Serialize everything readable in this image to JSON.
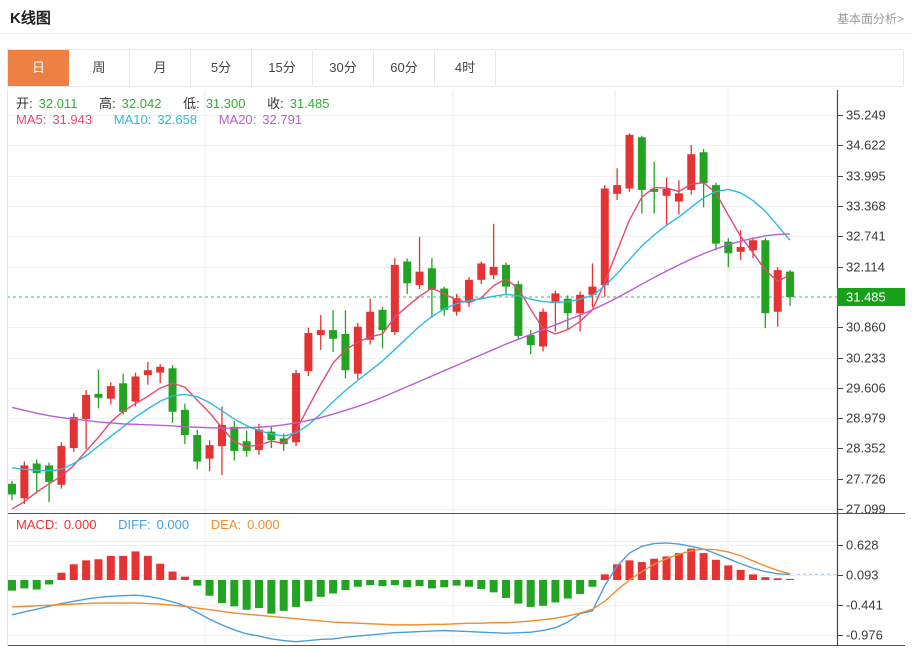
{
  "header": {
    "title": "K线图",
    "more_link": "基本面分析>"
  },
  "tabs": {
    "items": [
      "日",
      "周",
      "月",
      "5分",
      "15分",
      "30分",
      "60分",
      "4时"
    ],
    "active_index": 0
  },
  "ohlc_legend": {
    "open_label": "开:",
    "open_value": "32.011",
    "high_label": "高:",
    "high_value": "32.042",
    "low_label": "低:",
    "low_value": "31.300",
    "close_label": "收:",
    "close_value": "31.485"
  },
  "ma_legend": {
    "ma5_label": "MA5:",
    "ma5_value": "31.943",
    "ma10_label": "MA10:",
    "ma10_value": "32.658",
    "ma20_label": "MA20:",
    "ma20_value": "32.791"
  },
  "macd_legend": {
    "macd_label": "MACD:",
    "macd_value": "0.000",
    "diff_label": "DIFF:",
    "diff_value": "0.000",
    "dea_label": "DEA:",
    "dea_value": "0.000"
  },
  "colors": {
    "accent_orange": "#ee8043",
    "up_red": "#e53333",
    "down_green": "#22a422",
    "price_text_green": "#2db22d",
    "ma5_pink": "#e8476f",
    "ma10_cyan": "#29bcdc",
    "ma20_purple": "#bb5ed0",
    "diff_blue": "#4a9edc",
    "dea_orange": "#ef8d30",
    "current_price_bg": "#18a018",
    "dashed_green": "#3cb878",
    "grid": "#f0f0f0",
    "axis_dark": "#444444",
    "axis_text": "#3a3a3a",
    "link_gray": "#999999",
    "macd_tail_blue": "#a5c8e8"
  },
  "chart_data": {
    "type": "candlestick",
    "panes": [
      "price",
      "macd"
    ],
    "legend_position": "top-left",
    "grid": true,
    "current_price": "31.485",
    "price_axis_ticks": [
      "35.249",
      "34.622",
      "33.995",
      "33.368",
      "32.741",
      "32.114",
      "31.485",
      "30.860",
      "30.233",
      "29.606",
      "28.979",
      "28.352",
      "27.726",
      "27.099"
    ],
    "macd_axis_ticks": [
      "0.628",
      "0.093",
      "-0.441",
      "-0.976"
    ],
    "candles_ohlc": [
      [
        27.62,
        27.68,
        27.28,
        27.4
      ],
      [
        27.32,
        28.08,
        27.2,
        28.0
      ],
      [
        28.04,
        28.12,
        27.42,
        27.84
      ],
      [
        28.0,
        28.06,
        27.24,
        27.66
      ],
      [
        27.6,
        28.48,
        27.52,
        28.4
      ],
      [
        28.36,
        29.08,
        28.28,
        29.0
      ],
      [
        28.96,
        29.56,
        28.34,
        29.46
      ],
      [
        29.48,
        29.98,
        29.18,
        29.4
      ],
      [
        29.38,
        29.72,
        29.26,
        29.64
      ],
      [
        29.7,
        29.9,
        29.05,
        29.11
      ],
      [
        29.32,
        29.92,
        29.22,
        29.84
      ],
      [
        29.87,
        30.14,
        29.67,
        29.97
      ],
      [
        29.92,
        30.1,
        29.7,
        30.04
      ],
      [
        30.01,
        30.08,
        28.88,
        29.11
      ],
      [
        29.15,
        29.28,
        28.44,
        28.63
      ],
      [
        28.63,
        28.74,
        27.92,
        28.08
      ],
      [
        28.14,
        28.52,
        27.88,
        28.42
      ],
      [
        28.4,
        29.22,
        27.8,
        28.84
      ],
      [
        28.8,
        28.92,
        28.1,
        28.3
      ],
      [
        28.5,
        28.72,
        28.18,
        28.3
      ],
      [
        28.32,
        28.86,
        28.22,
        28.74
      ],
      [
        28.7,
        28.8,
        28.36,
        28.52
      ],
      [
        28.56,
        28.66,
        28.3,
        28.44
      ],
      [
        28.48,
        29.98,
        28.4,
        29.91
      ],
      [
        29.95,
        30.85,
        29.85,
        30.74
      ],
      [
        30.7,
        31.11,
        30.39,
        30.8
      ],
      [
        30.8,
        31.21,
        30.35,
        30.62
      ],
      [
        30.72,
        31.21,
        29.8,
        29.97
      ],
      [
        29.9,
        30.95,
        29.78,
        30.87
      ],
      [
        30.6,
        31.45,
        30.5,
        31.18
      ],
      [
        31.22,
        31.28,
        30.42,
        30.8
      ],
      [
        30.76,
        32.29,
        30.7,
        32.15
      ],
      [
        32.22,
        32.28,
        31.55,
        31.77
      ],
      [
        31.73,
        32.73,
        31.65,
        32.01
      ],
      [
        32.08,
        32.29,
        31.05,
        31.63
      ],
      [
        31.66,
        31.7,
        31.1,
        31.22
      ],
      [
        31.18,
        31.55,
        31.1,
        31.46
      ],
      [
        31.38,
        31.9,
        31.28,
        31.84
      ],
      [
        31.84,
        32.22,
        31.75,
        32.18
      ],
      [
        31.94,
        33.0,
        31.85,
        32.11
      ],
      [
        32.15,
        32.2,
        31.55,
        31.7
      ],
      [
        31.75,
        31.82,
        30.6,
        30.68
      ],
      [
        30.7,
        30.8,
        30.3,
        30.49
      ],
      [
        30.46,
        31.25,
        30.36,
        31.18
      ],
      [
        31.39,
        31.62,
        30.77,
        31.56
      ],
      [
        31.45,
        31.52,
        30.82,
        31.15
      ],
      [
        31.15,
        31.6,
        30.77,
        31.53
      ],
      [
        31.53,
        32.18,
        31.28,
        31.7
      ],
      [
        31.73,
        33.8,
        31.49,
        33.73
      ],
      [
        33.62,
        34.15,
        33.49,
        33.8
      ],
      [
        33.73,
        34.87,
        33.66,
        34.84
      ],
      [
        34.79,
        34.82,
        33.21,
        33.7
      ],
      [
        33.72,
        34.28,
        33.21,
        33.66
      ],
      [
        33.58,
        33.96,
        32.97,
        33.72
      ],
      [
        33.46,
        33.9,
        33.19,
        33.63
      ],
      [
        33.7,
        34.63,
        33.6,
        34.44
      ],
      [
        34.48,
        34.55,
        33.34,
        33.84
      ],
      [
        33.8,
        33.85,
        32.45,
        32.59
      ],
      [
        32.63,
        32.7,
        32.1,
        32.39
      ],
      [
        32.42,
        32.87,
        32.25,
        32.52
      ],
      [
        32.45,
        32.72,
        32.29,
        32.66
      ],
      [
        32.66,
        32.7,
        30.84,
        31.15
      ],
      [
        31.18,
        32.1,
        30.87,
        32.04
      ],
      [
        32.011,
        32.042,
        31.3,
        31.485
      ]
    ],
    "ma5": [
      27.1,
      27.25,
      27.45,
      27.62,
      27.78,
      28.0,
      28.3,
      28.58,
      28.9,
      29.12,
      29.28,
      29.43,
      29.6,
      29.7,
      29.62,
      29.35,
      29.09,
      28.78,
      28.49,
      28.39,
      28.42,
      28.5,
      28.46,
      28.72,
      29.21,
      29.68,
      30.12,
      30.39,
      30.55,
      30.66,
      30.72,
      31.07,
      31.29,
      31.5,
      31.67,
      31.55,
      31.42,
      31.37,
      31.47,
      31.72,
      31.86,
      31.66,
      31.23,
      30.83,
      30.72,
      30.81,
      30.98,
      31.22,
      31.79,
      32.44,
      33.08,
      33.55,
      33.75,
      33.74,
      33.67,
      33.82,
      33.85,
      33.64,
      33.18,
      32.74,
      32.4,
      32.04,
      31.81,
      31.94
    ],
    "ma10": [
      27.95,
      27.92,
      27.9,
      27.89,
      27.92,
      28.04,
      28.2,
      28.4,
      28.6,
      28.8,
      29.0,
      29.17,
      29.33,
      29.44,
      29.47,
      29.42,
      29.3,
      29.13,
      28.96,
      28.82,
      28.72,
      28.65,
      28.61,
      28.67,
      28.84,
      29.07,
      29.32,
      29.55,
      29.76,
      29.96,
      30.16,
      30.4,
      30.64,
      30.88,
      31.08,
      31.24,
      31.35,
      31.41,
      31.45,
      31.5,
      31.54,
      31.51,
      31.44,
      31.39,
      31.37,
      31.39,
      31.44,
      31.52,
      31.71,
      31.97,
      32.26,
      32.54,
      32.77,
      32.97,
      33.14,
      33.34,
      33.54,
      33.67,
      33.71,
      33.64,
      33.48,
      33.26,
      32.96,
      32.66
    ],
    "ma20": [
      29.2,
      29.14,
      29.08,
      29.03,
      28.99,
      28.96,
      28.93,
      28.9,
      28.88,
      28.86,
      28.85,
      28.84,
      28.83,
      28.82,
      28.8,
      28.79,
      28.78,
      28.77,
      28.77,
      28.78,
      28.79,
      28.81,
      28.84,
      28.88,
      28.93,
      28.99,
      29.06,
      29.14,
      29.22,
      29.31,
      29.41,
      29.52,
      29.63,
      29.74,
      29.85,
      29.96,
      30.07,
      30.18,
      30.29,
      30.4,
      30.51,
      30.61,
      30.71,
      30.81,
      30.91,
      31.01,
      31.11,
      31.22,
      31.34,
      31.47,
      31.61,
      31.75,
      31.89,
      32.02,
      32.15,
      32.27,
      32.38,
      32.48,
      32.57,
      32.64,
      32.7,
      32.75,
      32.78,
      32.79
    ],
    "macd_hist": [
      -0.19,
      -0.15,
      -0.17,
      -0.08,
      0.13,
      0.28,
      0.35,
      0.37,
      0.43,
      0.43,
      0.51,
      0.43,
      0.29,
      0.15,
      0.06,
      -0.1,
      -0.28,
      -0.41,
      -0.47,
      -0.53,
      -0.5,
      -0.6,
      -0.55,
      -0.48,
      -0.38,
      -0.3,
      -0.24,
      -0.18,
      -0.12,
      -0.09,
      -0.11,
      -0.09,
      -0.13,
      -0.11,
      -0.15,
      -0.13,
      -0.1,
      -0.12,
      -0.16,
      -0.22,
      -0.32,
      -0.42,
      -0.48,
      -0.46,
      -0.4,
      -0.33,
      -0.25,
      -0.12,
      0.1,
      0.28,
      0.35,
      0.32,
      0.38,
      0.42,
      0.48,
      0.56,
      0.48,
      0.36,
      0.26,
      0.18,
      0.1,
      0.05,
      0.03,
      0.02
    ],
    "diff_line": [
      -0.62,
      -0.57,
      -0.52,
      -0.47,
      -0.42,
      -0.38,
      -0.34,
      -0.31,
      -0.29,
      -0.28,
      -0.27,
      -0.29,
      -0.33,
      -0.39,
      -0.46,
      -0.58,
      -0.7,
      -0.8,
      -0.89,
      -0.96,
      -1.0,
      -1.05,
      -1.08,
      -1.1,
      -1.08,
      -1.06,
      -1.05,
      -1.02,
      -1.0,
      -0.98,
      -0.96,
      -0.94,
      -0.93,
      -0.92,
      -0.91,
      -0.9,
      -0.91,
      -0.92,
      -0.93,
      -0.94,
      -0.95,
      -0.94,
      -0.93,
      -0.9,
      -0.85,
      -0.75,
      -0.6,
      -0.55,
      -0.1,
      0.25,
      0.48,
      0.6,
      0.65,
      0.66,
      0.64,
      0.6,
      0.55,
      0.47,
      0.38,
      0.29,
      0.21,
      0.15,
      0.11,
      0.1
    ],
    "dea_line": [
      -0.48,
      -0.47,
      -0.46,
      -0.45,
      -0.44,
      -0.43,
      -0.42,
      -0.41,
      -0.41,
      -0.41,
      -0.41,
      -0.42,
      -0.43,
      -0.45,
      -0.47,
      -0.5,
      -0.53,
      -0.56,
      -0.59,
      -0.61,
      -0.63,
      -0.65,
      -0.67,
      -0.69,
      -0.71,
      -0.73,
      -0.75,
      -0.76,
      -0.77,
      -0.78,
      -0.79,
      -0.8,
      -0.8,
      -0.8,
      -0.79,
      -0.79,
      -0.78,
      -0.77,
      -0.77,
      -0.76,
      -0.76,
      -0.75,
      -0.73,
      -0.71,
      -0.68,
      -0.64,
      -0.59,
      -0.52,
      -0.38,
      -0.18,
      0.0,
      0.15,
      0.28,
      0.38,
      0.46,
      0.52,
      0.55,
      0.54,
      0.5,
      0.43,
      0.34,
      0.25,
      0.17,
      0.11
    ]
  }
}
